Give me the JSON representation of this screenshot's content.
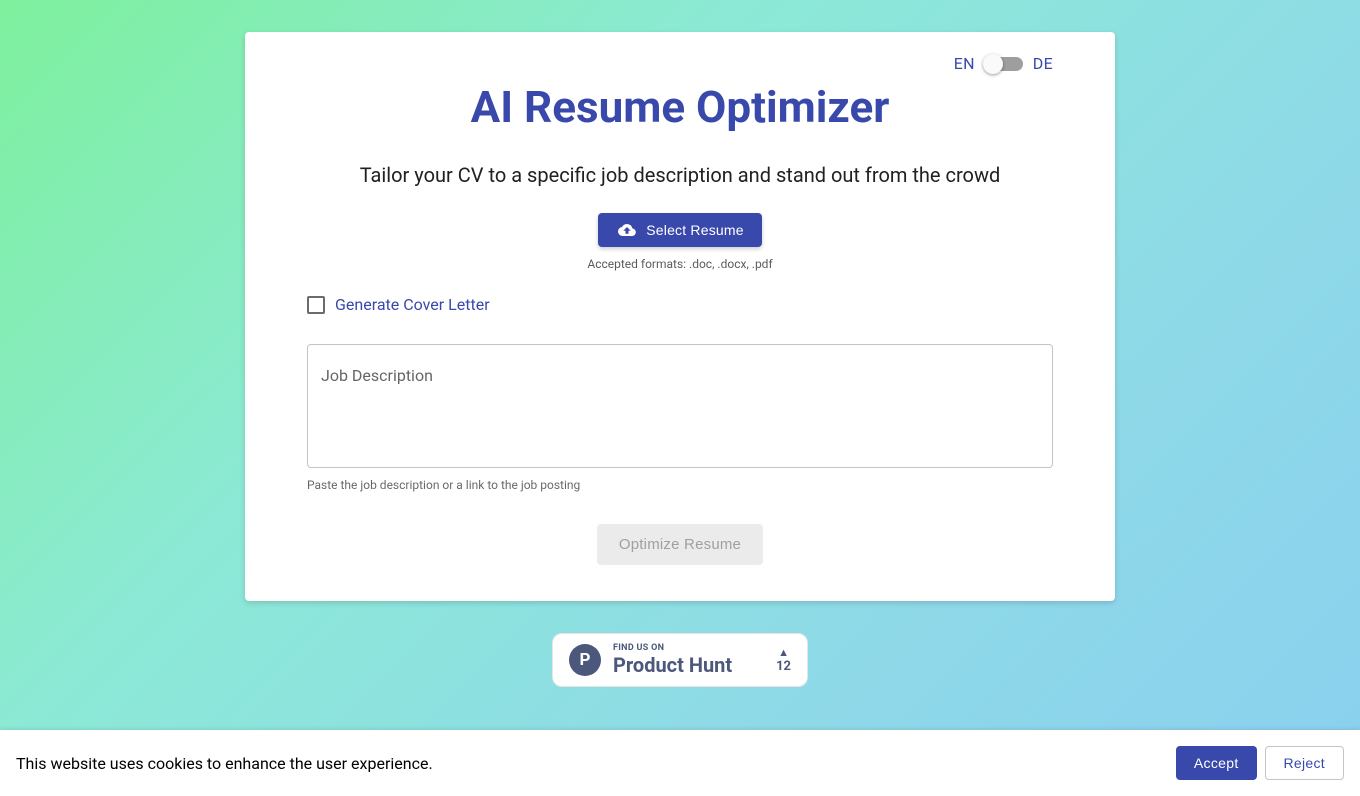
{
  "lang": {
    "left": "EN",
    "right": "DE"
  },
  "title": "AI Resume Optimizer",
  "subtitle": "Tailor your CV to a specific job description and stand out from the crowd",
  "upload": {
    "button": "Select Resume",
    "formats": "Accepted formats: .doc, .docx, .pdf"
  },
  "cover_letter": {
    "label": "Generate Cover Letter"
  },
  "job": {
    "label": "Job Description",
    "value": "",
    "helper": "Paste the job description or a link to the job posting"
  },
  "optimize_button": "Optimize Resume",
  "producthunt": {
    "find": "FIND US ON",
    "name": "Product Hunt",
    "votes": "12"
  },
  "cookies": {
    "text": "This website uses cookies to enhance the user experience.",
    "accept": "Accept",
    "reject": "Reject"
  }
}
